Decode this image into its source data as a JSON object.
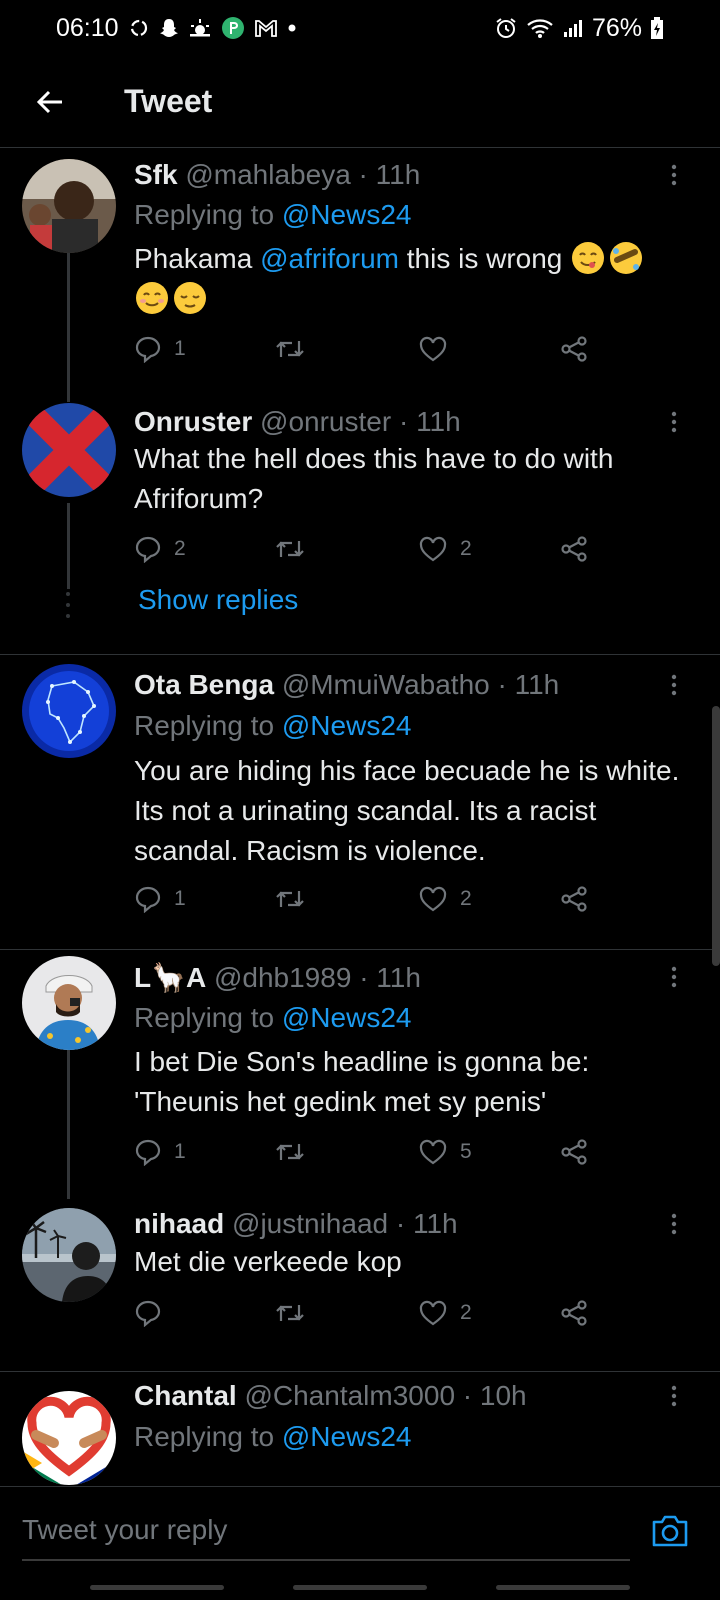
{
  "status_bar": {
    "time": "06:10",
    "battery": "76%",
    "notification_icons": [
      "sync-icon",
      "snapchat-icon",
      "weather-icon",
      "parking-app-icon",
      "gmail-icon",
      "dot-icon"
    ],
    "system_icons": [
      "alarm-icon",
      "wifi-icon",
      "signal-icon",
      "battery-icon"
    ]
  },
  "header": {
    "title": "Tweet",
    "back_icon": "arrow-left-icon"
  },
  "colors": {
    "background": "#000000",
    "text": "#e7e9ea",
    "secondary": "#71767b",
    "accent": "#1d9bf0",
    "divider": "#2f3336"
  },
  "tweets": [
    {
      "name": "Sfk",
      "handle": "@mahlabeya",
      "time": "11h",
      "replying_prefix": "Replying to",
      "replying_to": "@News24",
      "text_before": "Phakama ",
      "text_mention": "@afriforum",
      "text_after": " this is wrong",
      "emojis": [
        "face-savoring-food",
        "rolling-on-floor-laughing",
        "smiling-face-with-smiling-eyes",
        "relieved-face"
      ],
      "replies": "1",
      "retweets": "",
      "likes": "",
      "avatar_icon": "user-photo-avatar"
    },
    {
      "name": "Onruster",
      "handle": "@onruster",
      "time": "11h",
      "text": "What the hell does this have to do with Afriforum?",
      "replies": "2",
      "retweets": "",
      "likes": "2",
      "avatar_icon": "red-x-flag-avatar"
    },
    {
      "name": "Ota Benga",
      "handle": "@MmuiWabatho",
      "time": "11h",
      "replying_prefix": "Replying to",
      "replying_to": "@News24",
      "text": "You are hiding his face becuade he is white. Its not a urinating scandal. Its a racist  scandal. Racism is violence.",
      "replies": "1",
      "retweets": "",
      "likes": "2",
      "avatar_icon": "africa-network-avatar"
    },
    {
      "name": "L🦙A",
      "handle": "@dhb1989",
      "time": "11h",
      "replying_prefix": "Replying to",
      "replying_to": "@News24",
      "text": "I bet Die Son's headline is gonna be: 'Theunis het gedink met sy penis'",
      "replies": "1",
      "retweets": "",
      "likes": "5",
      "avatar_icon": "cartoon-person-avatar"
    },
    {
      "name": "nihaad",
      "handle": "@justnihaad",
      "time": "11h",
      "text": "Met die verkeede kop",
      "replies": "",
      "retweets": "",
      "likes": "2",
      "avatar_icon": "palm-trees-photo-avatar"
    },
    {
      "name": "Chantal",
      "handle": "@Chantalm3000",
      "time": "10h",
      "replying_prefix": "Replying to",
      "replying_to": "@News24",
      "avatar_icon": "heart-hands-flag-avatar"
    }
  ],
  "show_replies": "Show replies",
  "reply_bar": {
    "placeholder": "Tweet your reply",
    "camera_icon": "camera-icon"
  }
}
